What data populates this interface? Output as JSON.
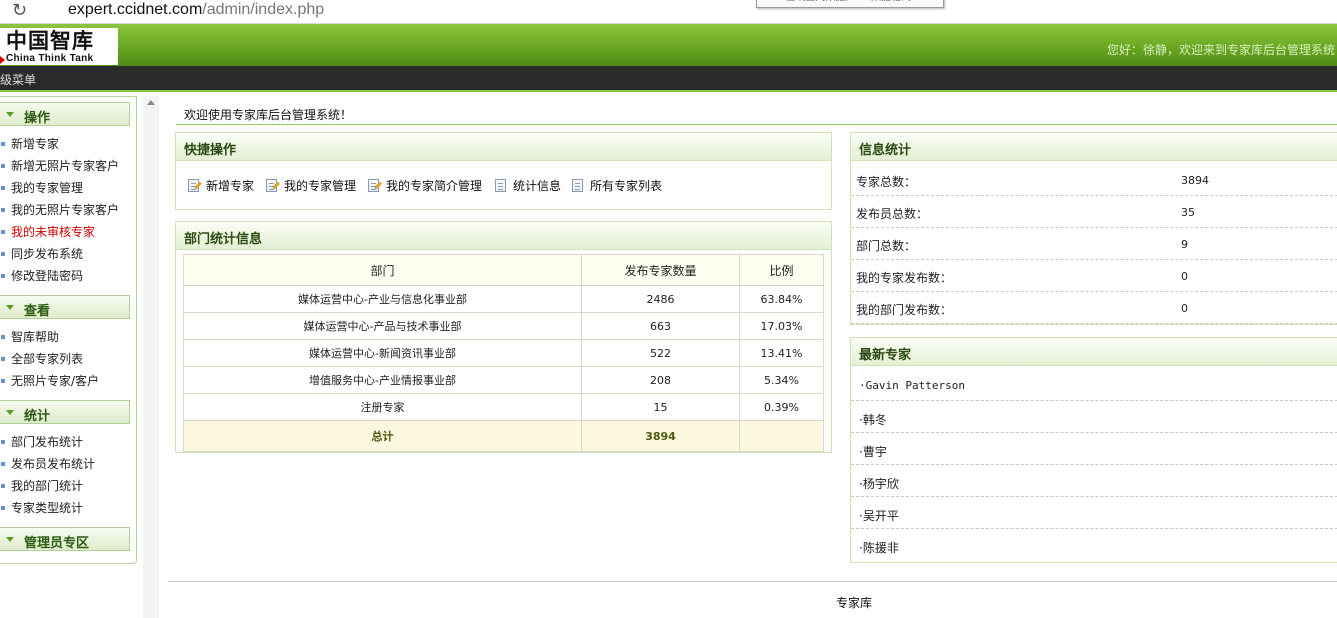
{
  "browser": {
    "url_host": "expert.ccidnet.com",
    "url_path": "/admin/index.php",
    "tooltip": "mdb在线查阅数据,mdb数据格式"
  },
  "header": {
    "logo_cn": "中国智库",
    "logo_en": "China Think Tank",
    "welcome": "您好：徐静，欢迎来到专家库后台管理系统",
    "menu_bar_label": "级菜单"
  },
  "sidebar": {
    "sections": [
      {
        "title": "操作",
        "items": [
          "新增专家",
          "新增无照片专家客户",
          "我的专家管理",
          "我的无照片专家客户",
          "我的未审核专家",
          "同步发布系统",
          "修改登陆密码"
        ]
      },
      {
        "title": "查看",
        "items": [
          "智库帮助",
          "全部专家列表",
          "无照片专家/客户"
        ]
      },
      {
        "title": "统计",
        "items": [
          "部门发布统计",
          "发布员发布统计",
          "我的部门统计",
          "专家类型统计"
        ]
      },
      {
        "title": "管理员专区",
        "items": []
      }
    ]
  },
  "main": {
    "welcome": "欢迎使用专家库后台管理系统！",
    "quick": {
      "title": "快捷操作",
      "items": [
        {
          "label": "新增专家",
          "icon": "edit-doc-icon"
        },
        {
          "label": "我的专家管理",
          "icon": "edit-doc-icon"
        },
        {
          "label": "我的专家简介管理",
          "icon": "edit-doc-icon"
        },
        {
          "label": "统计信息",
          "icon": "doc-icon"
        },
        {
          "label": "所有专家列表",
          "icon": "doc-icon"
        }
      ]
    },
    "dept": {
      "title": "部门统计信息",
      "headers": [
        "部门",
        "发布专家数量",
        "比例"
      ],
      "rows": [
        [
          "媒体运营中心-产业与信息化事业部",
          "2486",
          "63.84%"
        ],
        [
          "媒体运营中心-产品与技术事业部",
          "663",
          "17.03%"
        ],
        [
          "媒体运营中心-新闻资讯事业部",
          "522",
          "13.41%"
        ],
        [
          "增值服务中心-产业情报事业部",
          "208",
          "5.34%"
        ],
        [
          "注册专家",
          "15",
          "0.39%"
        ]
      ],
      "total_label": "总计",
      "total_value": "3894"
    },
    "stats": {
      "title": "信息统计",
      "rows": [
        {
          "label": "专家总数：",
          "value": "3894"
        },
        {
          "label": "发布员总数：",
          "value": "35"
        },
        {
          "label": "部门总数：",
          "value": "9"
        },
        {
          "label": "我的专家发布数：",
          "value": "0"
        },
        {
          "label": "我的部门发布数：",
          "value": "0"
        }
      ]
    },
    "latest": {
      "title": "最新专家",
      "items": [
        "·Gavin Patterson",
        "·韩冬",
        "·曹宇",
        "·杨宇欣",
        "·吴开平",
        "·陈援非"
      ]
    }
  },
  "footer": {
    "text": "专家库"
  },
  "colors": {
    "header_green": "#6aa722",
    "menu_bar": "#2b2b2b",
    "active_link": "#d00000"
  }
}
